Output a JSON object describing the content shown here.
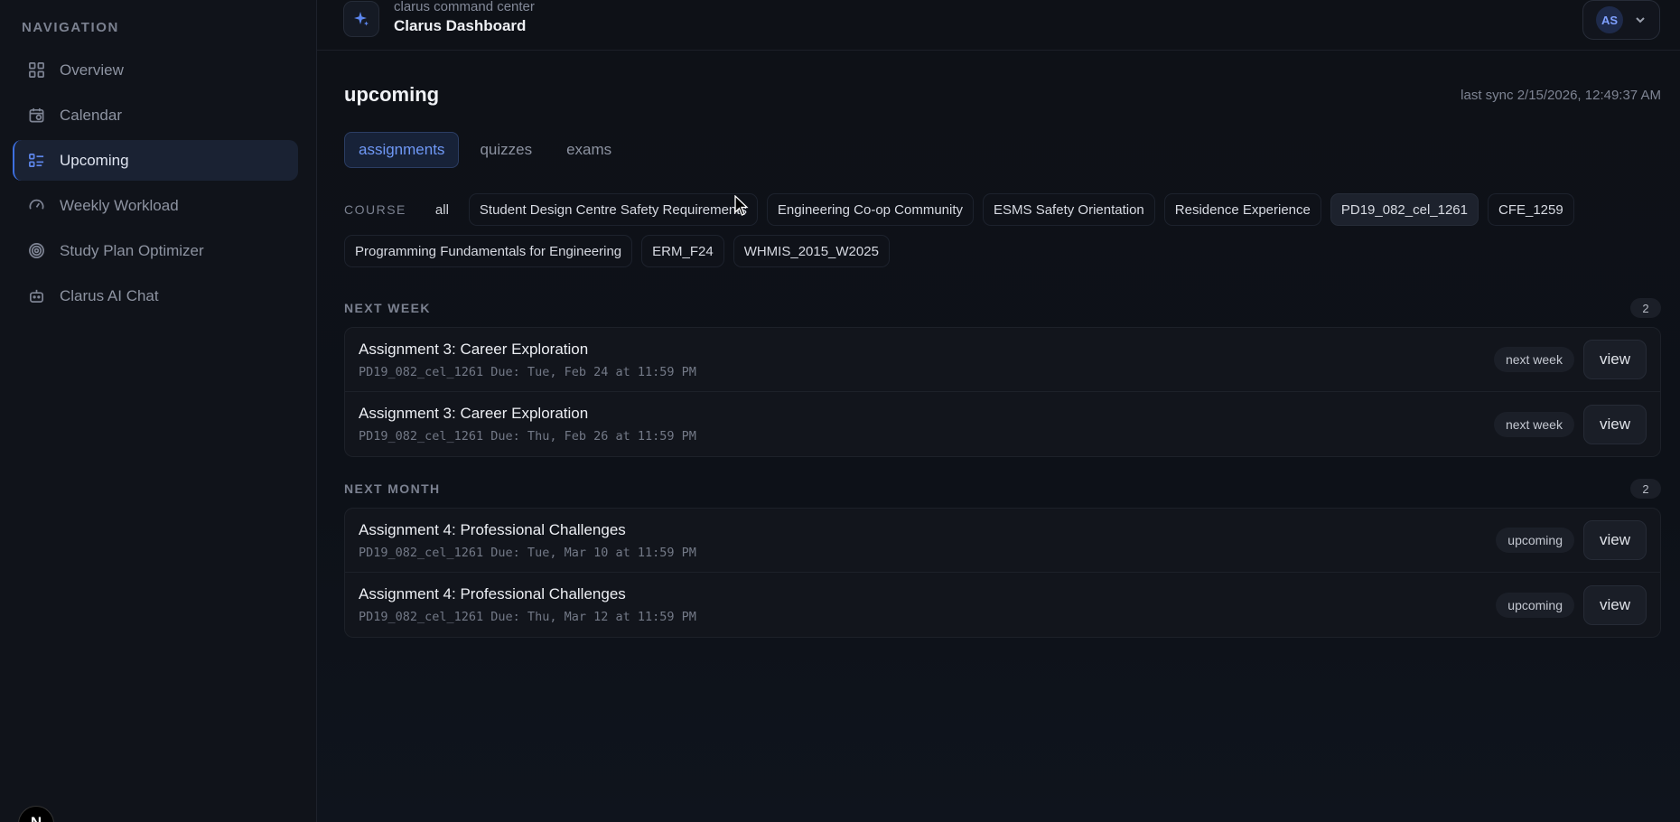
{
  "sidebar": {
    "heading": "NAVIGATION",
    "items": [
      {
        "label": "Overview",
        "icon": "grid-icon"
      },
      {
        "label": "Calendar",
        "icon": "calendar-icon"
      },
      {
        "label": "Upcoming",
        "icon": "list-icon",
        "active": true
      },
      {
        "label": "Weekly Workload",
        "icon": "gauge-icon"
      },
      {
        "label": "Study Plan Optimizer",
        "icon": "target-icon"
      },
      {
        "label": "Clarus AI Chat",
        "icon": "bot-icon"
      }
    ],
    "corner_badge": "N"
  },
  "topbar": {
    "subtitle": "clarus command center",
    "title": "Clarus Dashboard",
    "user_initials": "AS"
  },
  "page": {
    "title": "upcoming",
    "last_sync": "last sync 2/15/2026, 12:49:37 AM"
  },
  "tabs": [
    {
      "label": "assignments",
      "active": true
    },
    {
      "label": "quizzes"
    },
    {
      "label": "exams"
    }
  ],
  "filters": {
    "label": "COURSE",
    "chips": [
      "all",
      "Student Design Centre Safety Requirements",
      "Engineering Co-op Community",
      "ESMS Safety Orientation",
      "Residence Experience",
      "PD19_082_cel_1261",
      "CFE_1259",
      "Programming Fundamentals for Engineering",
      "ERM_F24",
      "WHMIS_2015_W2025"
    ],
    "selected": "PD19_082_cel_1261"
  },
  "sections": [
    {
      "title": "NEXT WEEK",
      "count": "2",
      "items": [
        {
          "title": "Assignment 3: Career Exploration",
          "meta": "PD19_082_cel_1261 Due: Tue, Feb 24 at 11:59 PM",
          "status": "next week",
          "action": "view"
        },
        {
          "title": "Assignment 3: Career Exploration",
          "meta": "PD19_082_cel_1261 Due: Thu, Feb 26 at 11:59 PM",
          "status": "next week",
          "action": "view"
        }
      ]
    },
    {
      "title": "NEXT MONTH",
      "count": "2",
      "items": [
        {
          "title": "Assignment 4: Professional Challenges",
          "meta": "PD19_082_cel_1261 Due: Tue, Mar 10 at 11:59 PM",
          "status": "upcoming",
          "action": "view"
        },
        {
          "title": "Assignment 4: Professional Challenges",
          "meta": "PD19_082_cel_1261 Due: Thu, Mar 12 at 11:59 PM",
          "status": "upcoming",
          "action": "view"
        }
      ]
    }
  ],
  "colors": {
    "accent": "#3d6fe0",
    "background": "#0c0f15",
    "sidebar": "#10131a"
  }
}
